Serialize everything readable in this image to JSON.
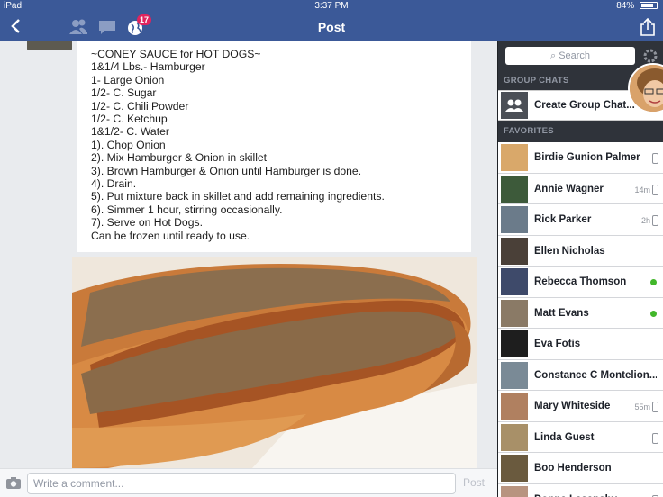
{
  "status_bar": {
    "device": "iPad",
    "time": "3:37 PM",
    "battery": "84%",
    "battery_level": 0.84
  },
  "nav": {
    "title": "Post",
    "notifications_badge": "17",
    "colors": {
      "bar": "#3b5998",
      "badge": "#e0245e"
    }
  },
  "post": {
    "lines": [
      "~CONEY SAUCE for HOT DOGS~",
      "1&1/4 Lbs.- Hamburger",
      "1- Large Onion",
      "1/2- C. Sugar",
      "1/2- C. Chili Powder",
      "1/2- C. Ketchup",
      "1&1/2- C. Water",
      "1). Chop Onion",
      "2). Mix Hamburger & Onion in skillet",
      "3). Brown Hamburger & Onion until Hamburger is done.",
      "4). Drain.",
      "5). Put mixture back in skillet and add remaining ingredients.",
      "6). Simmer 1 hour, stirring occasionally.",
      "7). Serve on Hot Dogs.",
      "Can be frozen until ready to use."
    ]
  },
  "comment_bar": {
    "placeholder": "Write a comment...",
    "post_label": "Post"
  },
  "sidebar": {
    "search_placeholder": "Search",
    "group_chats_header": "GROUP CHATS",
    "create_group_label": "Create Group Chat...",
    "favorites_header": "FAVORITES",
    "favorites": [
      {
        "name": "Birdie Gunion Palmer",
        "meta": "",
        "status": "mobile",
        "avatar_color": "#d9a86a"
      },
      {
        "name": "Annie Wagner",
        "meta": "14m",
        "status": "mobile",
        "avatar_color": "#3d5a3a"
      },
      {
        "name": "Rick Parker",
        "meta": "2h",
        "status": "mobile",
        "avatar_color": "#6b7b8a"
      },
      {
        "name": "Ellen Nicholas",
        "meta": "",
        "status": "none",
        "avatar_color": "#4a4038"
      },
      {
        "name": "Rebecca Thomson",
        "meta": "",
        "status": "online",
        "avatar_color": "#3e4a6a"
      },
      {
        "name": "Matt Evans",
        "meta": "",
        "status": "online",
        "avatar_color": "#8a7a66"
      },
      {
        "name": "Eva Fotis",
        "meta": "",
        "status": "none",
        "avatar_color": "#1e1e1e"
      },
      {
        "name": "Constance C Montelion...",
        "meta": "",
        "status": "none",
        "avatar_color": "#7a8a96"
      },
      {
        "name": "Mary Whiteside",
        "meta": "55m",
        "status": "mobile",
        "avatar_color": "#b08060"
      },
      {
        "name": "Linda Guest",
        "meta": "",
        "status": "mobile",
        "avatar_color": "#a89068"
      },
      {
        "name": "Boo Henderson",
        "meta": "",
        "status": "none",
        "avatar_color": "#6a5a3e"
      },
      {
        "name": "Donna Lasanshy",
        "meta": "",
        "status": "mobile",
        "avatar_color": "#b89480"
      }
    ]
  }
}
